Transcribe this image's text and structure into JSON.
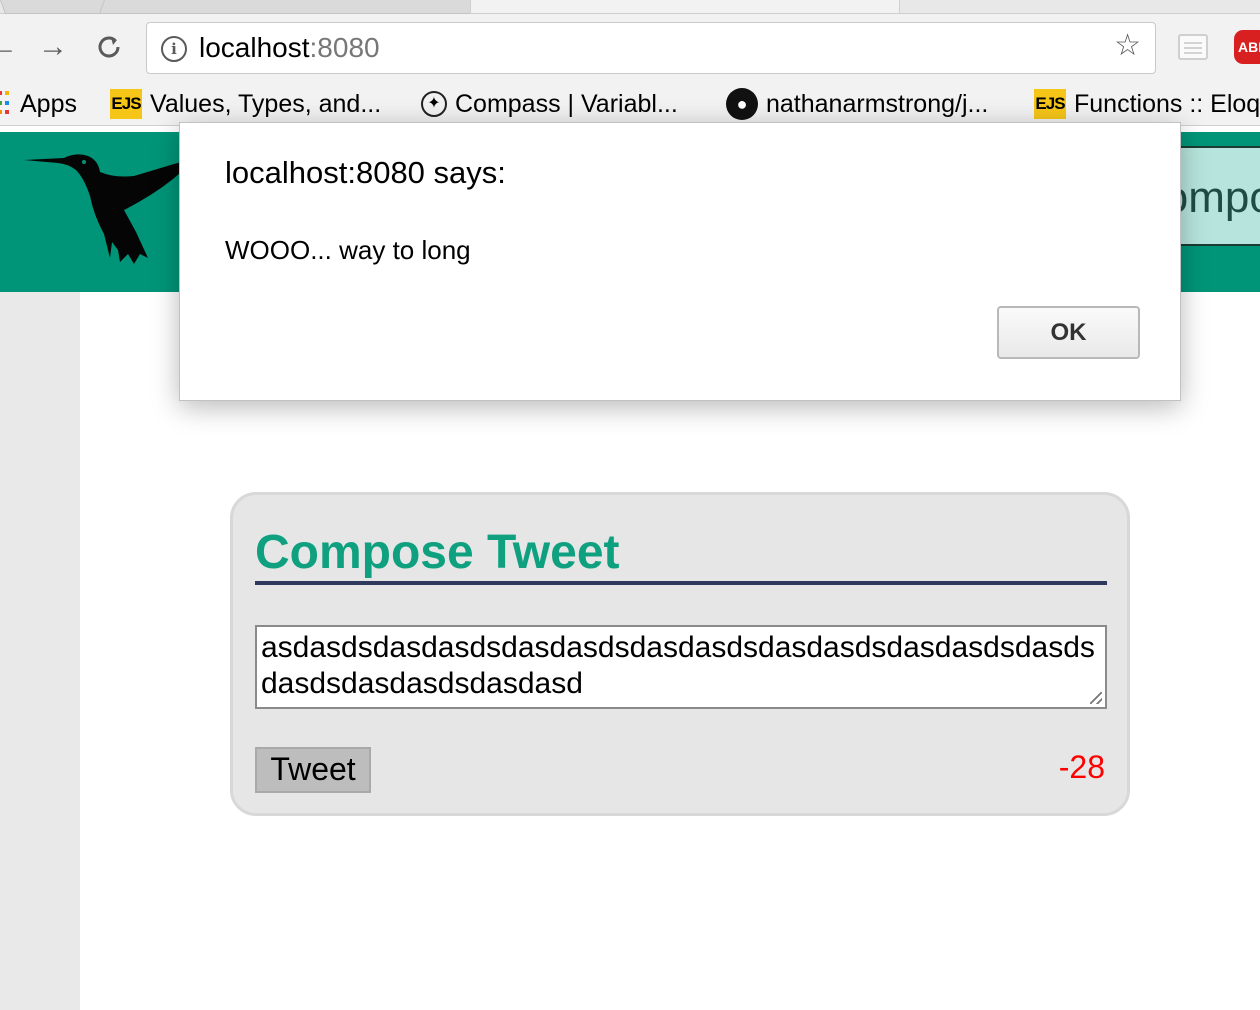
{
  "browser": {
    "url_host": "localhost",
    "url_port": ":8080",
    "bookmarks": [
      {
        "icon": "apps-icon",
        "label": "Apps"
      },
      {
        "icon": "ejs-icon",
        "label": "Values, Types, and..."
      },
      {
        "icon": "compass-icon",
        "label": "Compass | Variabl..."
      },
      {
        "icon": "github-icon",
        "label": "nathanarmstrong/j..."
      },
      {
        "icon": "ejs-icon",
        "label": "Functions :: Eloq"
      }
    ],
    "ejs_icon_text": "EJS",
    "abp_icon_text": "ABP"
  },
  "header": {
    "compose_button_label": "Compo",
    "brand_color": "#009578"
  },
  "compose": {
    "title": "Compose Tweet",
    "textarea_value": "asdasdsdasdasdsdasdasdsdasdasdsdasdasdsdasdasdsdasdsdasdsdasdasdsdasdasd",
    "tweet_button_label": "Tweet",
    "counter": "-28",
    "counter_color": "#ff0000"
  },
  "dialog": {
    "title": "localhost:8080 says:",
    "message": "WOOO... way to long",
    "ok_label": "OK"
  }
}
